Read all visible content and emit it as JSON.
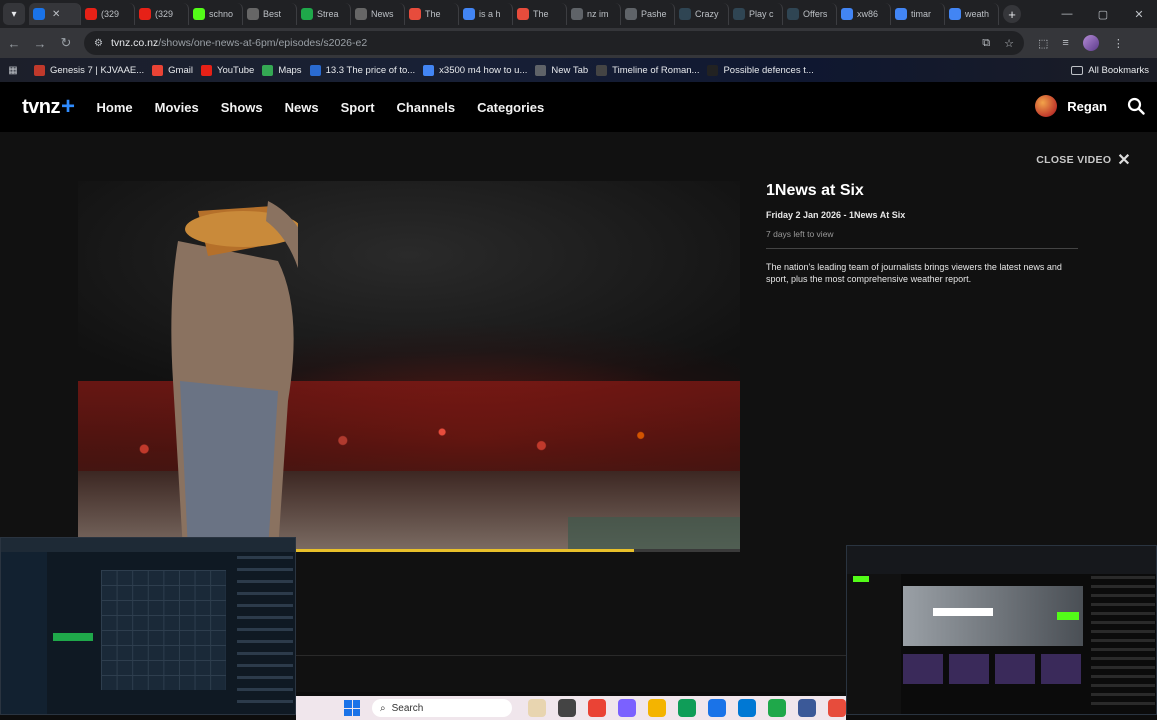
{
  "browser": {
    "tabs": [
      {
        "label": "",
        "favicon": "tvnz-icon",
        "color": "#1a73e8",
        "active": true
      },
      {
        "label": "(329",
        "favicon": "youtube-icon",
        "color": "#e62117"
      },
      {
        "label": "(329",
        "favicon": "youtube-icon",
        "color": "#e62117"
      },
      {
        "label": "schno",
        "favicon": "kick-icon",
        "color": "#53fc18"
      },
      {
        "label": "Best",
        "favicon": "page-icon",
        "color": "#666666"
      },
      {
        "label": "Strea",
        "favicon": "stream-icon",
        "color": "#1fa84a"
      },
      {
        "label": "News",
        "favicon": "page-icon",
        "color": "#666666"
      },
      {
        "label": "The",
        "favicon": "record-icon",
        "color": "#e74c3c"
      },
      {
        "label": "is a h",
        "favicon": "google-icon",
        "color": "#4285f4"
      },
      {
        "label": "The",
        "favicon": "record-icon",
        "color": "#e74c3c"
      },
      {
        "label": "nz im",
        "favicon": "globe-icon",
        "color": "#5f6368"
      },
      {
        "label": "Pashe",
        "favicon": "blank-icon",
        "color": "#5f6368"
      },
      {
        "label": "Crazy",
        "favicon": "stake-icon",
        "color": "#2f4553"
      },
      {
        "label": "Play c",
        "favicon": "stake-icon",
        "color": "#2f4553"
      },
      {
        "label": "Offers",
        "favicon": "stake-icon",
        "color": "#2f4553"
      },
      {
        "label": "xw86",
        "favicon": "google-icon",
        "color": "#4285f4"
      },
      {
        "label": "timar",
        "favicon": "google-icon",
        "color": "#4285f4"
      },
      {
        "label": "weath",
        "favicon": "google-icon",
        "color": "#4285f4"
      }
    ],
    "url_host": "tvnz.co.nz",
    "url_path": "/shows/one-news-at-6pm/episodes/s2026-e2",
    "bookmarks": [
      {
        "label": "Genesis 7 | KJVAAE...",
        "color": "#c0392b"
      },
      {
        "label": "Gmail",
        "color": "#ea4335"
      },
      {
        "label": "YouTube",
        "color": "#e62117"
      },
      {
        "label": "Maps",
        "color": "#34a853"
      },
      {
        "label": "13.3 The price of to...",
        "color": "#2a6bd1"
      },
      {
        "label": "x3500 m4 how to u...",
        "color": "#4285f4"
      },
      {
        "label": "New Tab",
        "color": "#5f6368"
      },
      {
        "label": "Timeline of Roman...",
        "color": "#444444"
      },
      {
        "label": "Possible defences t...",
        "color": "#222222"
      }
    ],
    "all_bookmarks": "All Bookmarks"
  },
  "site": {
    "logo": "tvnz",
    "nav": [
      "Home",
      "Movies",
      "Shows",
      "News",
      "Sport",
      "Channels",
      "Categories"
    ],
    "user": "Regan",
    "close_video": "CLOSE VIDEO"
  },
  "episode": {
    "title": "1News at Six",
    "meta": "Friday 2 Jan 2026 - 1News At Six",
    "availability": "7 days left to view",
    "description": "The nation's leading team of journalists brings viewers the latest news and sport, plus the most comprehensive weather report.",
    "progress": 0.84
  },
  "taskbar": {
    "search_placeholder": "Search",
    "icons": [
      "#e8d5b0",
      "#444444",
      "#ea4335",
      "#7b61ff",
      "#f4b400",
      "#0f9d58",
      "#1a73e8",
      "#0078d4",
      "#1fa84a",
      "#3b5998",
      "#e74c3c"
    ]
  }
}
